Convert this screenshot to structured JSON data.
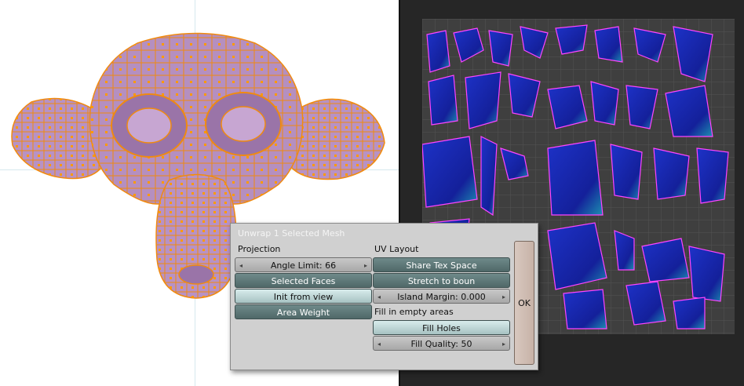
{
  "dialog": {
    "title": "Unwrap 1 Selected Mesh",
    "projection_label": "Projection",
    "uv_layout_label": "UV Layout",
    "angle_limit": "Angle Limit: 66",
    "selected_faces": "Selected Faces",
    "init_from_view": "Init from view",
    "area_weight": "Area Weight",
    "share_tex_space": "Share Tex Space",
    "stretch_to_bounds": "Stretch to boun",
    "island_margin": "Island Margin: 0.000",
    "fill_empty_label": "Fill in empty areas",
    "fill_holes": "Fill Holes",
    "fill_quality": "Fill Quality: 50",
    "ok": "OK"
  },
  "icons": {
    "left_arrow": "◂",
    "right_arrow": "▸"
  },
  "colors": {
    "mesh_face": "#b58fc0",
    "mesh_wire": "#ff8c00",
    "uv_island": "#1a2bb0",
    "uv_edge": "#ff44ff",
    "uv_background": "#3e3e3e",
    "button_dark": "#5b7575",
    "button_light": "#c0d8d8"
  }
}
